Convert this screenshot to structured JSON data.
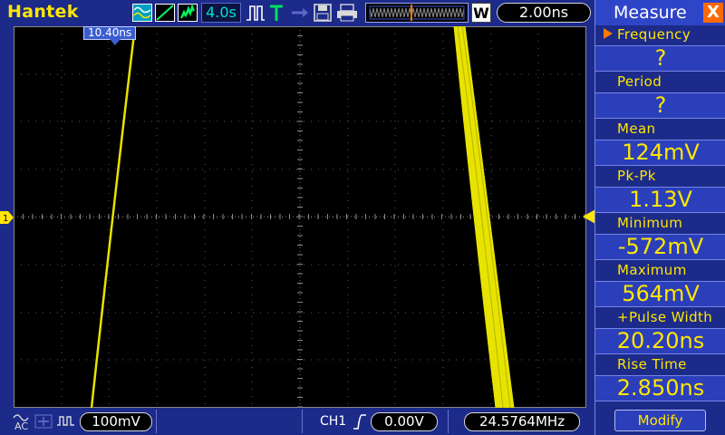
{
  "header": {
    "brand": "Hantek",
    "acquire_time": "4.0s",
    "timebase": "2.00ns",
    "window_badge": "W",
    "icons": [
      "waveform-icon",
      "edge-icon",
      "noise-icon",
      "pulse-icon",
      "trigger-t-icon",
      "arrow-icon",
      "save-icon",
      "print-icon"
    ]
  },
  "plot": {
    "trigger_time": "10.40ns",
    "channel_marker": "1",
    "trace_color": "#e7e300"
  },
  "footer": {
    "coupling": "AC",
    "volts_per_div": "100mV",
    "channel": "CH1",
    "trigger_level": "0.00V",
    "frequency": "24.5764MHz"
  },
  "measure": {
    "title": "Measure",
    "close": "X",
    "items": [
      {
        "label": "Frequency",
        "value": "?"
      },
      {
        "label": "Period",
        "value": "?"
      },
      {
        "label": "Mean",
        "value": "124mV"
      },
      {
        "label": "Pk-Pk",
        "value": "1.13V"
      },
      {
        "label": "Minimum",
        "value": "-572mV"
      },
      {
        "label": "Maximum",
        "value": "564mV"
      },
      {
        "label": "+Pulse Width",
        "value": "20.20ns"
      },
      {
        "label": "Rise Time",
        "value": "2.850ns"
      }
    ],
    "modify": "Modify"
  },
  "colors": {
    "background": "#1c2a8a",
    "accent_yellow": "#ffe600",
    "accent_cyan": "#00e0d0",
    "close_orange": "#ff6a00"
  }
}
